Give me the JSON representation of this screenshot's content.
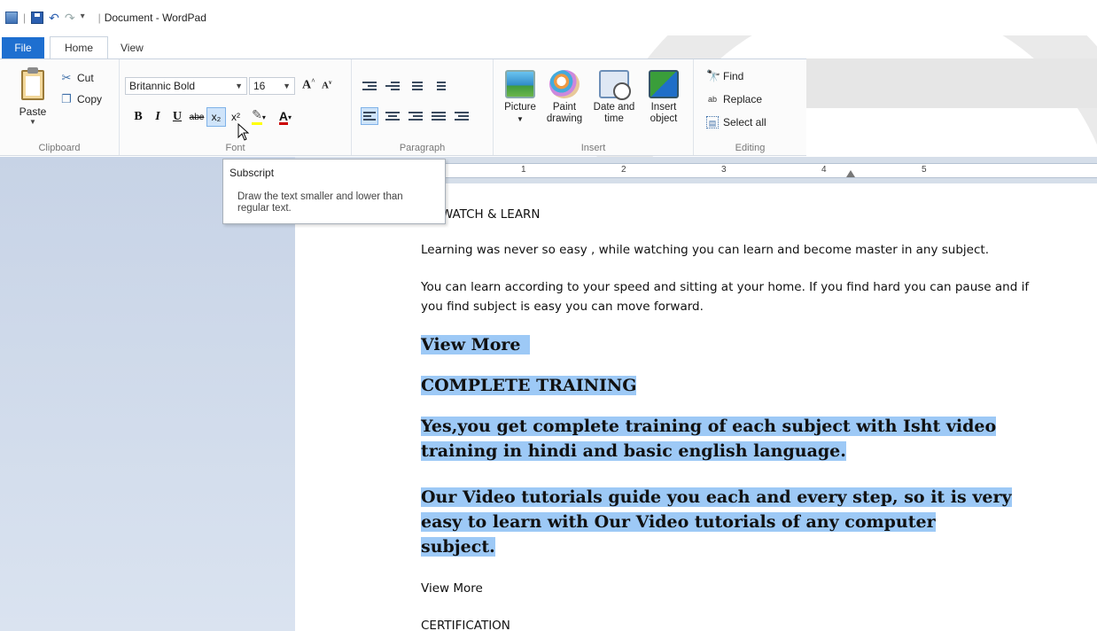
{
  "title_bar": {
    "title": "Document - WordPad",
    "qa_separator": "|",
    "qa_dropdown": "⇑"
  },
  "tabs": [
    {
      "label": "File"
    },
    {
      "label": "Home"
    },
    {
      "label": "View"
    }
  ],
  "ribbon": {
    "clipboard": {
      "paste": "Paste",
      "cut": "Cut",
      "copy": "Copy",
      "group": "Clipboard"
    },
    "font": {
      "name": "Britannic Bold",
      "size": "16",
      "group": "Font",
      "grow": "A",
      "shrink": "A",
      "bold": "B",
      "italic": "I",
      "underline": "U",
      "strike": "abe",
      "subscript": "x₂",
      "superscript": "x²",
      "color_letter": "A"
    },
    "paragraph": {
      "group": "Paragraph"
    },
    "insert": {
      "picture": "Picture",
      "paint": "Paint drawing",
      "datetime": "Date and time",
      "object": "Insert object",
      "group": "Insert"
    },
    "editing": {
      "find": "Find",
      "replace": "Replace",
      "select_all": "Select all",
      "group": "Editing"
    }
  },
  "ruler": {
    "numbers": [
      "1",
      "2",
      "3",
      "4",
      "5"
    ]
  },
  "tooltip": {
    "title": "Subscript",
    "body": "Draw the text smaller and lower than regular text."
  },
  "document": {
    "heading": "Y, WATCH & LEARN",
    "para1": "Learning was never so easy , while watching you can learn and become master in any subject.",
    "para2": "You can learn according to your speed and sitting at your home. If you find hard you can pause and if you find subject is easy you can move forward.",
    "sel1": "View More",
    "sel2": "COMPLETE TRAINING",
    "sel3_l1": "Yes,you get complete training of each subject with Isht video",
    "sel3_l2": "training in hindi and basic english language.",
    "sel4_l1": "Our Video tutorials guide you each and every step, so it is very",
    "sel4_l2": "easy to learn with Our Video tutorials of any computer",
    "sel4_l3": "subject.",
    "after1": "View More",
    "after2": "CERTIFICATION"
  },
  "colors": {
    "file_tab": "#1e6fd0",
    "selection": "#9dc9f6",
    "sidebar": "#c7d3e6"
  }
}
